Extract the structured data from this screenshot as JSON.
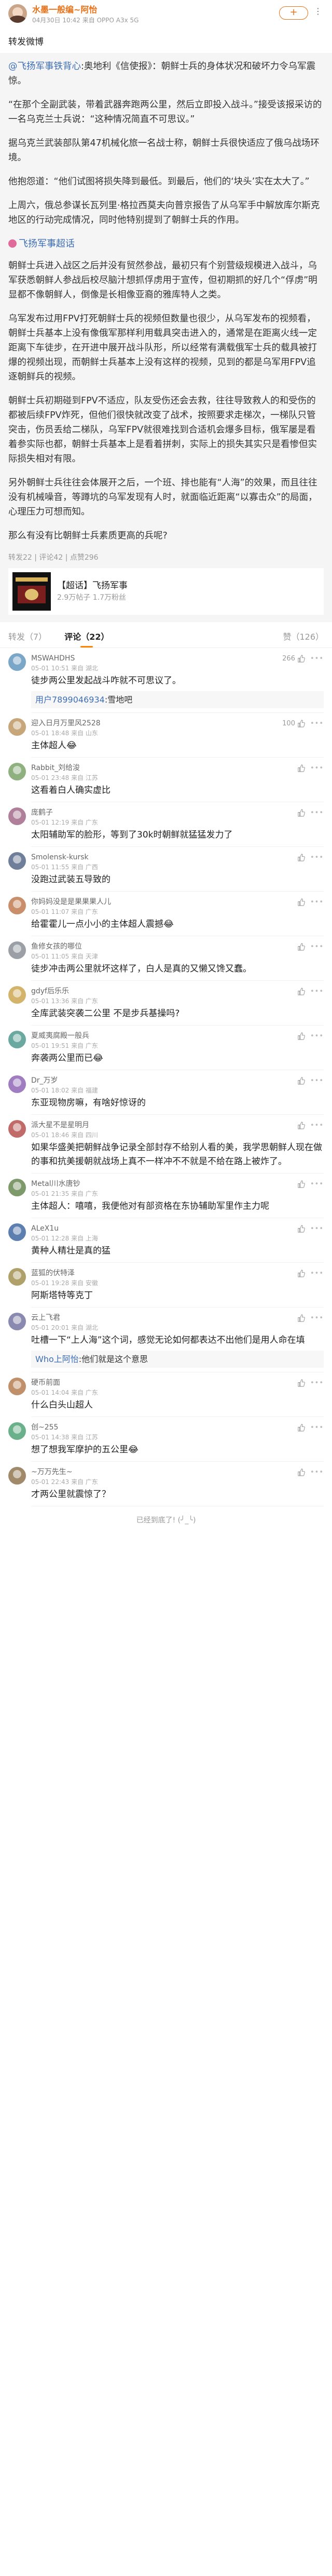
{
  "colors": {
    "accent": "#e8731a",
    "link": "#3d6db5",
    "like_red": "#e03e3e",
    "gray": "#999999"
  },
  "header": {
    "name": "水墨一般编~阿怡",
    "meta": "04月30日 10:42  来自 OPPO A3x 5G",
    "follow_label": "+",
    "more_icon": "more-icon"
  },
  "repost_label": "转发微博",
  "quote": {
    "source": "@飞扬军事铁背心",
    "p1_rest": ":奥地利《信使报》：朝鲜士兵的身体状况和破坏力令乌军震惊。",
    "p2": "“在那个全副武装，带着武器奔跑两公里，然后立即投入战斗。”接受该报采访的一名乌克兰士兵说：“这种情况简直不可思议。”",
    "p3": "据乌克兰武装部队第47机械化旅一名战士称，朝鲜士兵很快适应了俄乌战场环境。",
    "p4": "他抱怨道：“他们试图将损失降到最低。到最后，他们的‘块头’实在太大了。”",
    "p5": "上周六，俄总参谋长瓦列里·格拉西莫夫向普京报告了从乌军手中解放库尔斯克地区的行动完成情况，同时他特别提到了朝鲜士兵的作用。",
    "tag": "飞扬军事超话",
    "p6": "朝鲜士兵进入战区之后并没有贸然参战，最初只有个别营级规模进入战斗，乌军获悉朝鲜人参战后校尽脑汁想抓俘虏用于宣传，但初期抓的好几个“俘虏”明显都不像朝鲜人，倒像是长相像亚裔的雅库特人之类。",
    "p7": "乌军发布过用FPV打死朝鲜士兵的视频但数量也很少，从乌军发布的视频看，朝鲜士兵基本上没有像俄军那样利用载具突击进入的，通常是在距离火线一定距离下车徒步，在开进中展开战斗队形，所以经常有满载俄军士兵的载具被打爆的视频出现，而朝鲜士兵基本上没有这样的视频，见到的都是乌军用FPV追逐朝鲜兵的视频。",
    "p8": "朝鲜士兵初期碰到FPV不适应，队友受伤还会去救，往往导致救人的和受伤的都被后续FPV炸死，但他们很快就改变了战术，按照要求走梯次，一梯队只管突击，伤员丢给二梯队，乌军FPV就很难找到合适机会爆多目标，俄军屡是看着参实际也都，朝鲜士兵基本上是看着拼刺，实际上的损失其实只是看惨但实际损失相对有限。",
    "p9": "另外朝鲜士兵往往会体展开之后，一个班、排也能有“人海”的效果，而且往往没有机械噪音，等蹲坑的乌军发现有人时，就面临近距离“以寡击众”的局面，心理压力可想而知。",
    "p10": "那么有没有比朝鲜士兵素质更高的兵呢?",
    "meta": "转发22 | 评论42 | 点赞296",
    "card": {
      "title": "【超话】飞扬军事",
      "sub": "2.9万帖子  1.7万粉丝"
    }
  },
  "tabs": {
    "repost": "转发（7）",
    "comment": "评论（22）",
    "like": "赞（126）"
  },
  "comments": [
    {
      "name": "MSWAHDHS",
      "time": "05-01 10:51  来自 湖北",
      "likes": "266",
      "text": "徒步两公里发起战斗咋就不可思议了。",
      "reply": {
        "name": "用户7899046934",
        "text": ":雪地吧"
      }
    },
    {
      "name": "迎入日月万里风2528",
      "time": "05-01 18:48  来自 山东",
      "likes": "100",
      "text": "主体超人😂"
    },
    {
      "name": "Rabbit_刘给浚",
      "time": "05-01 23:48  来自 江苏",
      "likes": "",
      "text": "这看着白人确实虚比"
    },
    {
      "name": "庞鹤子",
      "time": "05-01 12:19  来自 广东",
      "likes": "",
      "text": "太阳辅助军的脸形，等到了30k时朝鲜就猛猛发力了"
    },
    {
      "name": "Smolensk-kursk",
      "time": "05-01 11:55  来自 广西",
      "likes": "",
      "text": "没跑过武装五导致的"
    },
    {
      "name": "你妈妈没是是果果果人儿",
      "time": "05-01 11:07  来自 广东",
      "likes": "",
      "text": "给霍霍儿一点小小的主体超人震撼😂"
    },
    {
      "name": "鱼修女孩的哪位",
      "time": "05-01 11:05  来自 天津",
      "likes": "",
      "text": "徒步冲击两公里就坏这样了，白人是真的又懒又馋又蠢。"
    },
    {
      "name": "gdyf后乐乐",
      "time": "05-01 13:36  来自 广东",
      "likes": "",
      "text": "全库武装突袭二公里 不是步兵基操吗?"
    },
    {
      "name": "夏威夷腐殿一般兵",
      "time": "05-01 19:51  来自 广东",
      "likes": "",
      "text": "奔袭两公里而已😂"
    },
    {
      "name": "Dr_万岁",
      "time": "05-01 18:02  来自 福建",
      "likes": "",
      "text": "东亚现物房嘛，有啥好惊讶的"
    },
    {
      "name": "派大星不是星明月",
      "time": "05-01 18:46  来自 四川",
      "likes": "",
      "text": "如果华盛美把朝鲜战争记录全部封存不给别人看的美，我学思朝鲜人现在做的事和抗美援朝就战场上真不一样冲不不就是不给在路上被炸了。"
    },
    {
      "name": "Metal川水唐钞",
      "time": "05-01 21:35  来自 广东",
      "likes": "",
      "text": "主体超人：嘻嘻，我便他对有部资格在东协辅助军里作主力呢"
    },
    {
      "name": "ALeX1u",
      "time": "05-01 12:28  来自 上海",
      "likes": "",
      "text": "黄种人精壮是真的猛"
    },
    {
      "name": "蓝狐的伏特泽",
      "time": "05-01 19:28  来自 安徽",
      "likes": "",
      "text": "阿斯塔特等克丁"
    },
    {
      "name": "云上飞君",
      "time": "05-01 20:01  来自 湖北",
      "likes": "",
      "text": "吐槽一下“上人海”这个词，感觉无论如何都表达不出他们是用人命在填",
      "reply": {
        "name": "Who上阿怡",
        "text": ":他们就是这个意思"
      }
    },
    {
      "name": "硬币前面",
      "time": "05-01 14:04  来自 广东",
      "likes": "",
      "text": "什么白头山超人"
    },
    {
      "name": "创~255",
      "time": "05-01 14:38  来自 江苏",
      "likes": "",
      "text": "想了想我军摩护的五公里😂"
    },
    {
      "name": "~万万先生~",
      "time": "05-01 22:43  来自 广东",
      "likes": "",
      "text": "才两公里就震惊了？"
    }
  ],
  "tail": "已经到底了!  (╯_╰)"
}
